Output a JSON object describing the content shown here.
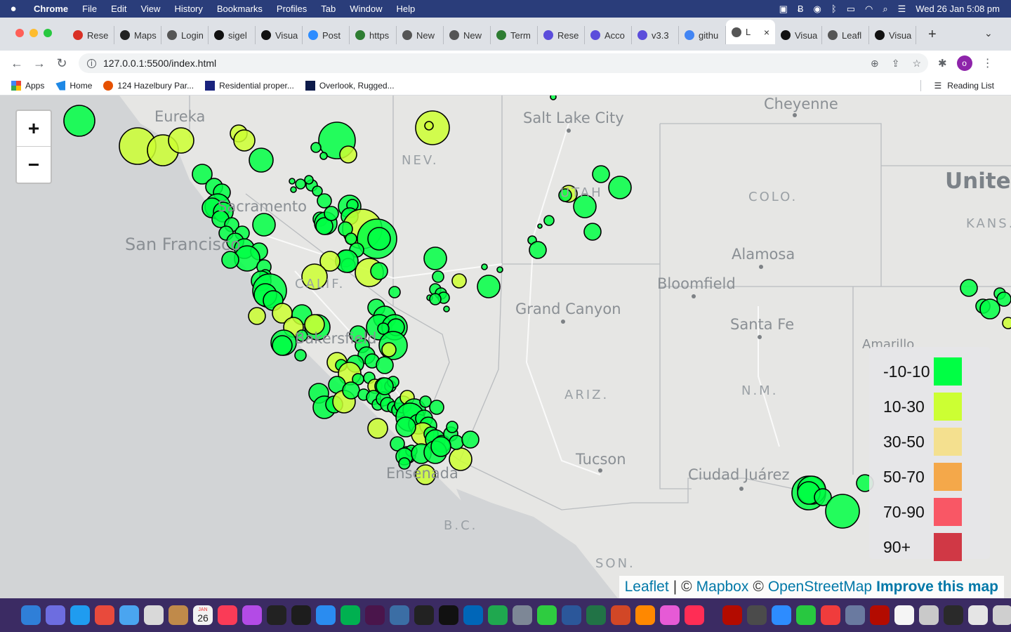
{
  "menubar": {
    "app": "Chrome",
    "items": [
      "File",
      "Edit",
      "View",
      "History",
      "Bookmarks",
      "Profiles",
      "Tab",
      "Window",
      "Help"
    ],
    "datetime": "Wed 26 Jan  5:08 pm"
  },
  "tabs": [
    {
      "label": "Rese",
      "icon": "gmail-icon",
      "color": "#d93025"
    },
    {
      "label": "Maps",
      "icon": "maps-icon",
      "color": "#222"
    },
    {
      "label": "Login",
      "icon": "globe-icon",
      "color": "#555"
    },
    {
      "label": "sigel",
      "icon": "github-icon",
      "color": "#111"
    },
    {
      "label": "Visua",
      "icon": "github-icon",
      "color": "#111"
    },
    {
      "label": "Post",
      "icon": "zoom-icon",
      "color": "#2d8cff"
    },
    {
      "label": "https",
      "icon": "chart-icon",
      "color": "#2e7d32"
    },
    {
      "label": "New",
      "icon": "globe-icon",
      "color": "#555"
    },
    {
      "label": "New",
      "icon": "globe-icon",
      "color": "#555"
    },
    {
      "label": "Term",
      "icon": "tool-icon",
      "color": "#2e7d32"
    },
    {
      "label": "Rese",
      "icon": "lens-icon",
      "color": "#5b4ddb"
    },
    {
      "label": "Acco",
      "icon": "lens-icon",
      "color": "#5b4ddb"
    },
    {
      "label": "v3.3",
      "icon": "lens-icon",
      "color": "#5b4ddb"
    },
    {
      "label": "githu",
      "icon": "google-icon",
      "color": "#4285f4"
    },
    {
      "label": "L",
      "icon": "globe-icon",
      "color": "#555",
      "active": true
    },
    {
      "label": "Visua",
      "icon": "github-icon",
      "color": "#111"
    },
    {
      "label": "Leafl",
      "icon": "globe-icon",
      "color": "#555"
    },
    {
      "label": "Visua",
      "icon": "github-icon",
      "color": "#111"
    }
  ],
  "address": {
    "url": "127.0.0.1:5500/index.html"
  },
  "profile_initial": "o",
  "bookmarks": [
    {
      "label": "Apps",
      "icon": "apps-grid-icon"
    },
    {
      "label": "Home",
      "icon": "home-bookmark-icon"
    },
    {
      "label": "124 Hazelbury Par...",
      "icon": "property-icon"
    },
    {
      "label": "Residential proper...",
      "icon": "residential-icon"
    },
    {
      "label": "Overlook, Rugged...",
      "icon": "sf-icon"
    }
  ],
  "reading_list": "Reading List",
  "map": {
    "labels": {
      "eureka": "Eureka",
      "sacramento": "Sacramento",
      "san_francisco": "San Francisco",
      "nev": "NEV.",
      "salt_lake_city": "Salt Lake City",
      "utah": "UTAH",
      "cheyenne": "Cheyenne",
      "colo": "COLO.",
      "kans": "KANS.",
      "united": "United",
      "alamosa": "Alamosa",
      "bloomfield": "Bloomfield",
      "grand_canyon": "Grand Canyon",
      "santa_fe": "Santa Fe",
      "amarillo": "Amarillo",
      "calif": "CALIF.",
      "bakersfield": "Bakersfield",
      "ariz": "ARIZ.",
      "nm": "N.M.",
      "tucson": "Tucson",
      "ciudad_juarez": "Ciudad Juárez",
      "ensenada": "Ensenada",
      "bc": "B.C.",
      "son": "SON."
    },
    "zoom_in": "+",
    "zoom_out": "−"
  },
  "legend": [
    {
      "label": "-10-10",
      "color": "#00ff44"
    },
    {
      "label": "10-30",
      "color": "#ccff33"
    },
    {
      "label": "30-50",
      "color": "#f4e08f"
    },
    {
      "label": "50-70",
      "color": "#f4a84a"
    },
    {
      "label": "70-90",
      "color": "#f95765"
    },
    {
      "label": "90+",
      "color": "#d03845"
    }
  ],
  "attribution": {
    "leaflet": "Leaflet",
    "sep": "|",
    "copy1": "©",
    "mapbox": "Mapbox",
    "copy2": "©",
    "osm": "OpenStreetMap",
    "improve": "Improve this map"
  },
  "dock": {
    "calendar_day": "26",
    "calendar_month": "JAN"
  }
}
